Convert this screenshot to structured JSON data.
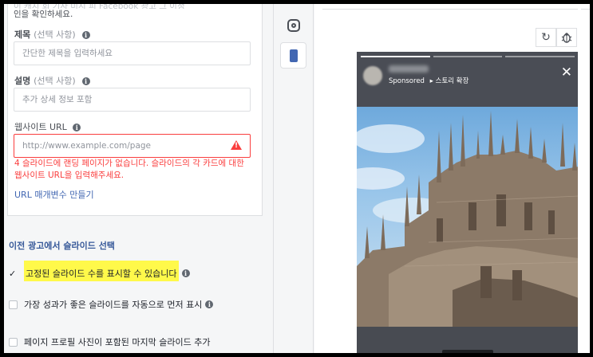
{
  "form": {
    "top_note_cut": "이 캐치 회 기사 미시 피 Facebook 광고 그 이정",
    "top_note_tail": "인을 확인하세요.",
    "title_label": "제목",
    "title_optional": "(선택 사항)",
    "title_placeholder": "간단한 제목을 입력하세요",
    "desc_label": "설명",
    "desc_optional": "(선택 사항)",
    "desc_placeholder": "추가 상세 정보 포함",
    "url_label": "웹사이트 URL",
    "url_placeholder": "http://www.example.com/page",
    "url_error": "4 슬라이드에 랜딩 페이지가 없습니다. 슬라이드의 각 카드에 대한 웹사이트 URL을 입력해주세요.",
    "url_params_link": "URL 매개변수 만들기"
  },
  "options": {
    "section_title": "이전 광고에서 슬라이드 선택",
    "fixed_slides": "고정된 슬라이드 수를 표시할 수 있습니다",
    "best_first": "가장 성과가 좋은 슬라이드를 자동으로 먼저 표시",
    "profile_end_card": "페이지 프로필 사진이 포함된 마지막 슬라이드 추가"
  },
  "preview": {
    "sponsored": "Sponsored",
    "story_expand": "▸ 스토리 확장",
    "refresh_icon": "↻",
    "bug_icon": "bug-icon",
    "close_icon": "✕",
    "progress": [
      1.0,
      0.0,
      0.0
    ]
  },
  "colors": {
    "error": "#fa3e3e",
    "link": "#4267b2",
    "highlight": "#fff94a"
  }
}
